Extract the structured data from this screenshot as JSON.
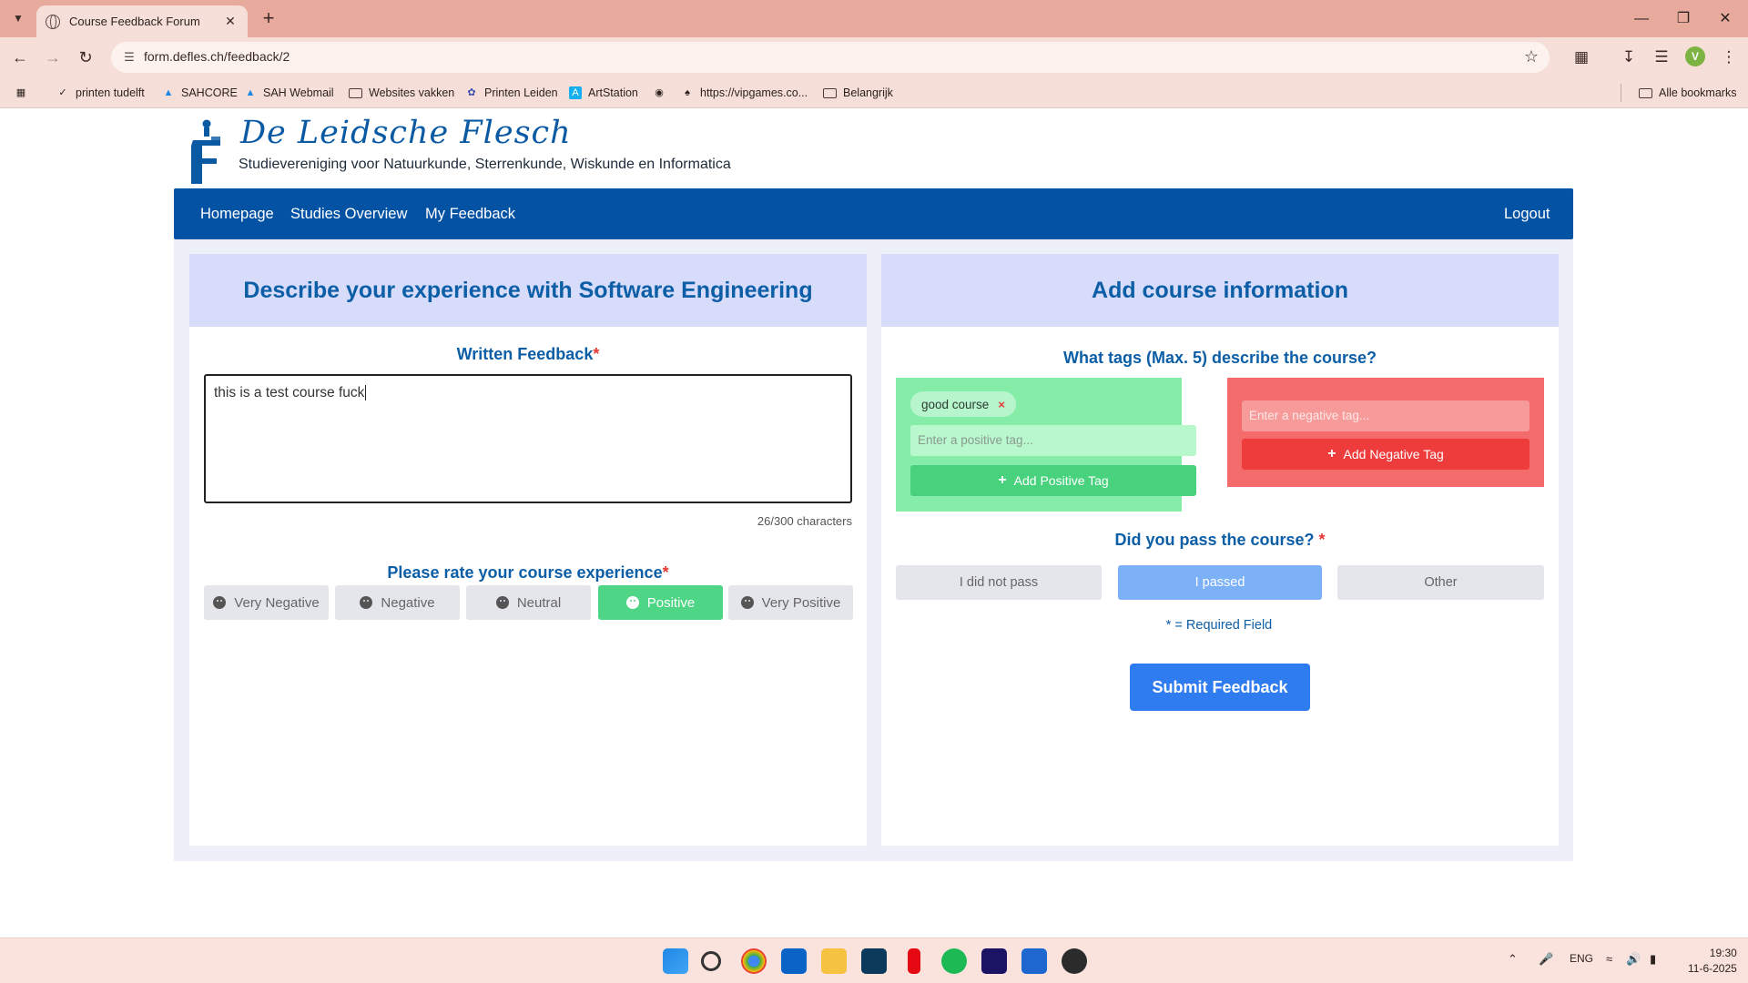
{
  "browser": {
    "tab_title": "Course Feedback Forum",
    "url": "form.defles.ch/feedback/2",
    "bookmarks": [
      "printen tudelft",
      "SAHCORE",
      "SAH Webmail",
      "Websites vakken",
      "Printen Leiden",
      "ArtStation",
      "https://vipgames.co...",
      "Belangrijk"
    ],
    "all_bookmarks": "Alle bookmarks",
    "profile_initial": "V"
  },
  "site": {
    "title": "De Leidsche Flesch",
    "subtitle": "Studievereniging voor Natuurkunde, Sterrenkunde, Wiskunde en Informatica",
    "nav": {
      "homepage": "Homepage",
      "studies_overview": "Studies Overview",
      "my_feedback": "My Feedback",
      "logout": "Logout"
    }
  },
  "left_panel": {
    "heading": "Describe your experience with Software Engineering",
    "written_label": "Written Feedback",
    "required_mark": "*",
    "feedback_text": "this is a test course fuck",
    "char_count": "26/300 characters",
    "rating_label": "Please rate your course experience",
    "ratings": [
      "Very Negative",
      "Negative",
      "Neutral",
      "Positive",
      "Very Positive"
    ],
    "selected_rating": "Positive"
  },
  "right_panel": {
    "heading": "Add course information",
    "tags_label": "What tags (Max. 5) describe the course?",
    "positive_tags": [
      "good course"
    ],
    "tag_remove": "×",
    "positive_placeholder": "Enter a positive tag...",
    "add_positive": "Add Positive Tag",
    "negative_placeholder": "Enter a negative tag...",
    "add_negative": "Add Negative Tag",
    "pass_label": "Did you pass the course?",
    "pass_options": [
      "I did not pass",
      "I passed",
      "Other"
    ],
    "selected_pass": "I passed",
    "required_note": "* = Required Field",
    "submit": "Submit Feedback"
  },
  "taskbar": {
    "language": "ENG",
    "time": "19:30",
    "date": "11-6-2025"
  },
  "colors": {
    "brand_blue": "#0452a3",
    "heading_blue": "#0c5ea6",
    "positive_green": "#4ed585",
    "negative_red": "#ee3b3b",
    "submit_blue": "#2f7cf0"
  }
}
